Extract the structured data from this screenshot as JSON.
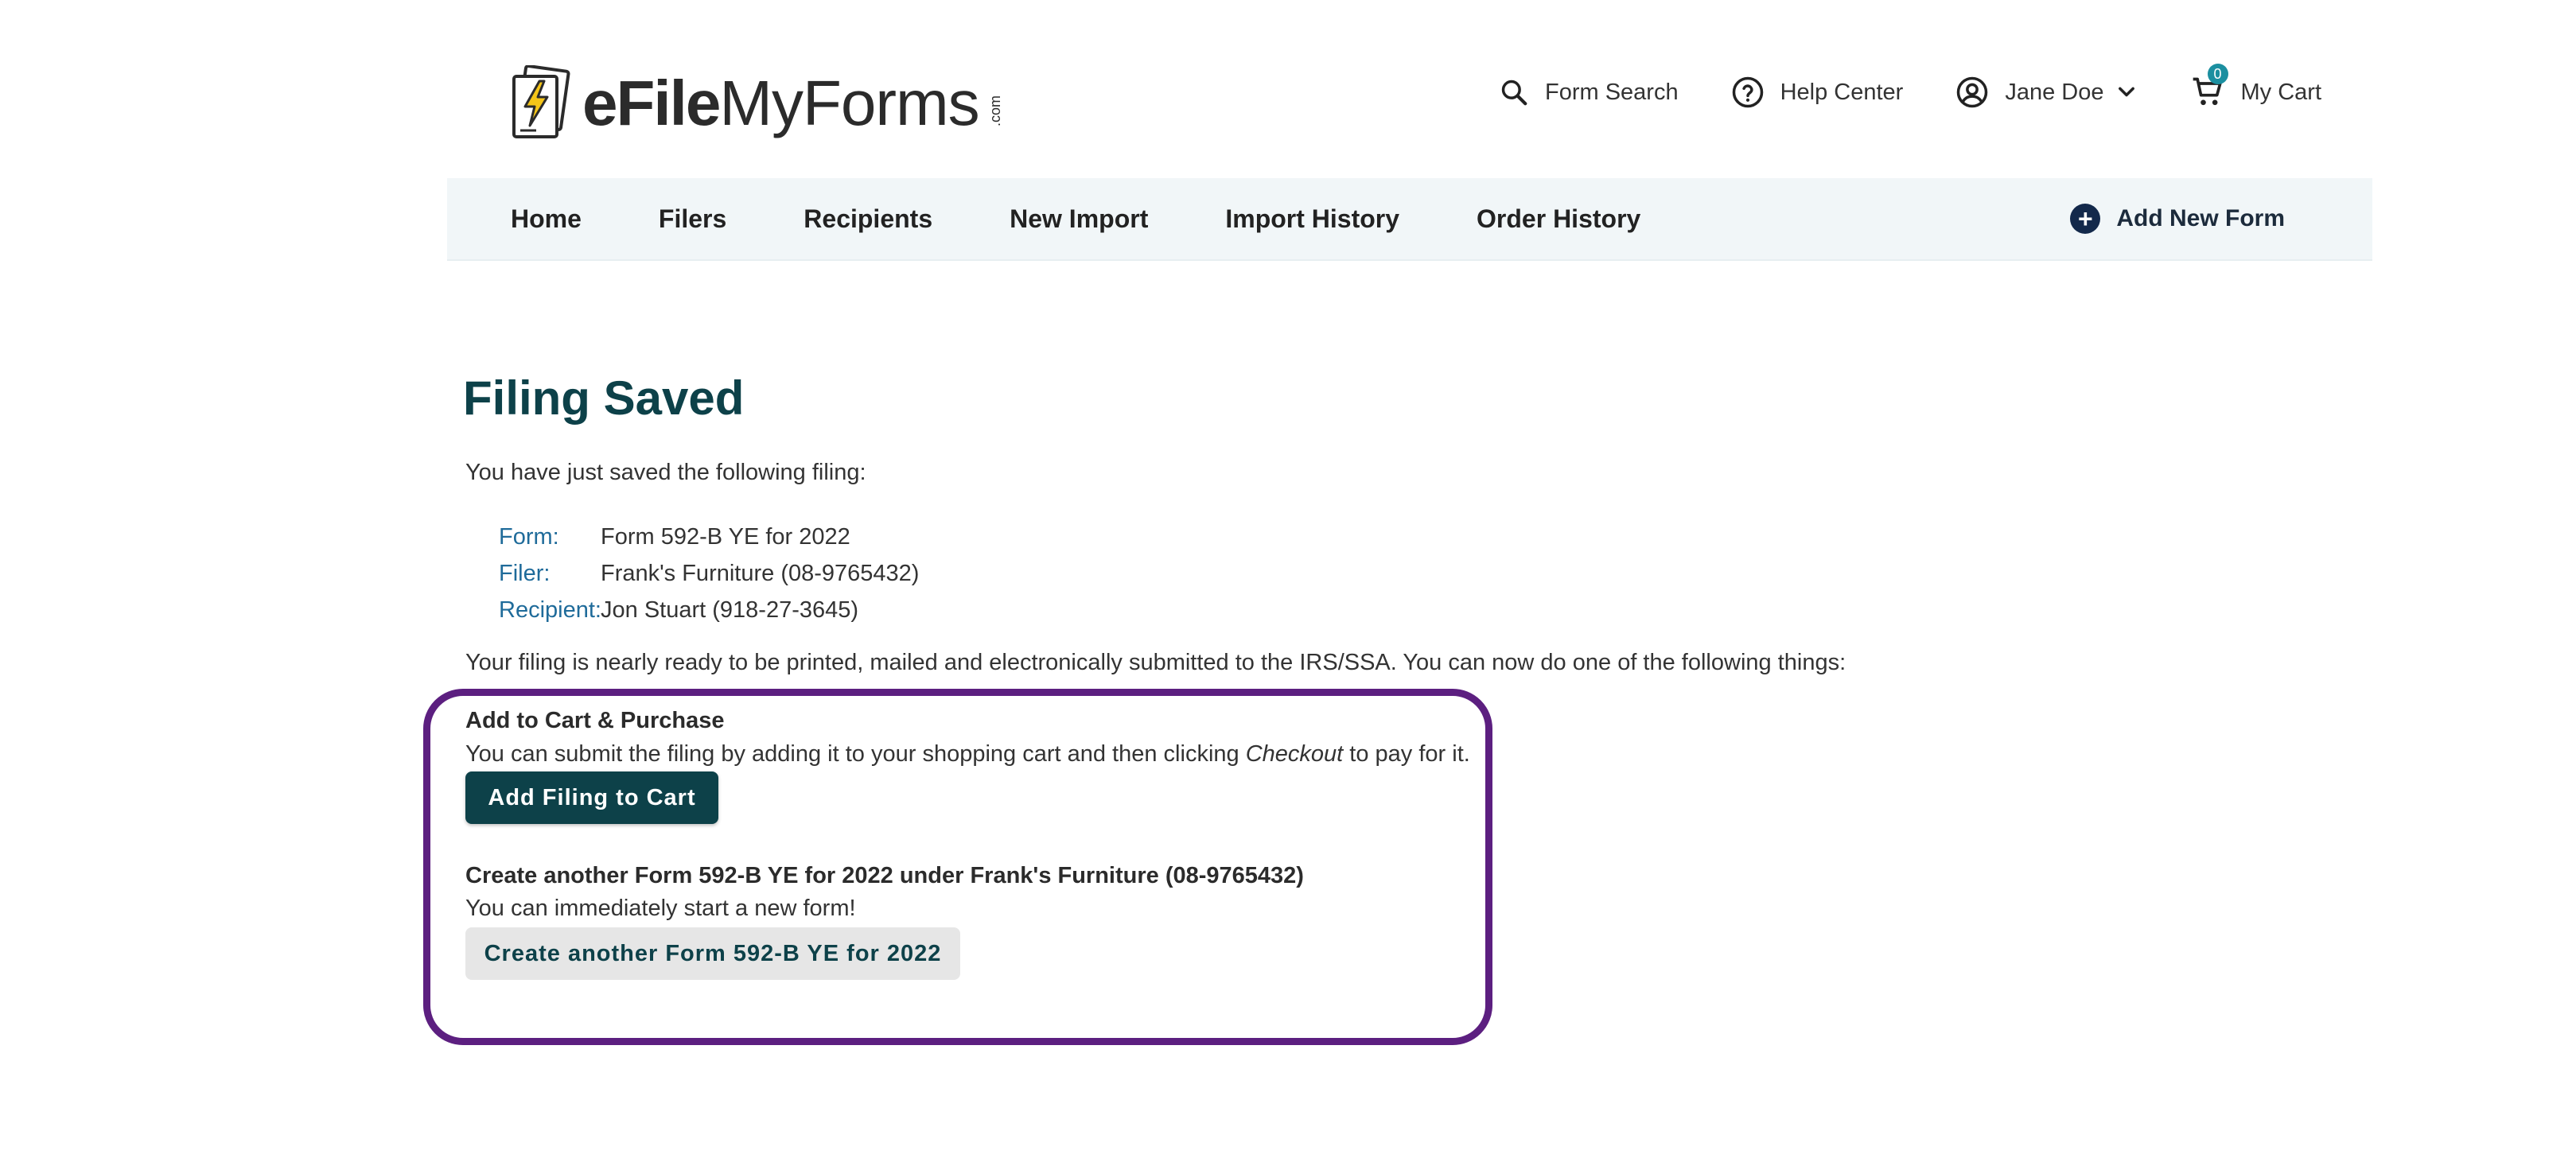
{
  "header": {
    "logo": {
      "part1": "eFile",
      "part2": "MyForms",
      "suffix": ".com"
    },
    "links": {
      "form_search": "Form Search",
      "help_center": "Help Center",
      "user_name": "Jane Doe",
      "cart_label": "My Cart",
      "cart_count": "0"
    }
  },
  "nav": {
    "items": [
      "Home",
      "Filers",
      "Recipients",
      "New Import",
      "Import History",
      "Order History"
    ],
    "add_new_form": "Add New Form"
  },
  "main": {
    "title": "Filing Saved",
    "intro": "You have just saved the following filing:",
    "details": [
      {
        "label": "Form:",
        "value": "Form 592-B YE for 2022"
      },
      {
        "label": "Filer:",
        "value": "Frank's Furniture (08-9765432)"
      },
      {
        "label": "Recipient:",
        "value": "Jon Stuart (918-27-3645)"
      }
    ],
    "status": "Your filing is nearly ready to be printed, mailed and electronically submitted to the IRS/SSA. You can now do one of the following things:",
    "cart_section": {
      "title": "Add to Cart & Purchase",
      "desc_before": "You can submit the filing by adding it to your shopping cart and then clicking ",
      "desc_em": "Checkout",
      "desc_after": " to pay for it.",
      "button": "Add Filing to Cart"
    },
    "create_section": {
      "title": "Create another Form 592-B YE for 2022 under Frank's Furniture (08-9765432)",
      "desc": "You can immediately start a new form!",
      "button": "Create another Form 592-B YE for 2022"
    }
  },
  "colors": {
    "primary": "#0d4149",
    "highlight": "#5c1f80",
    "link": "#1f6b9a",
    "nav_bg": "#f1f6f8"
  }
}
